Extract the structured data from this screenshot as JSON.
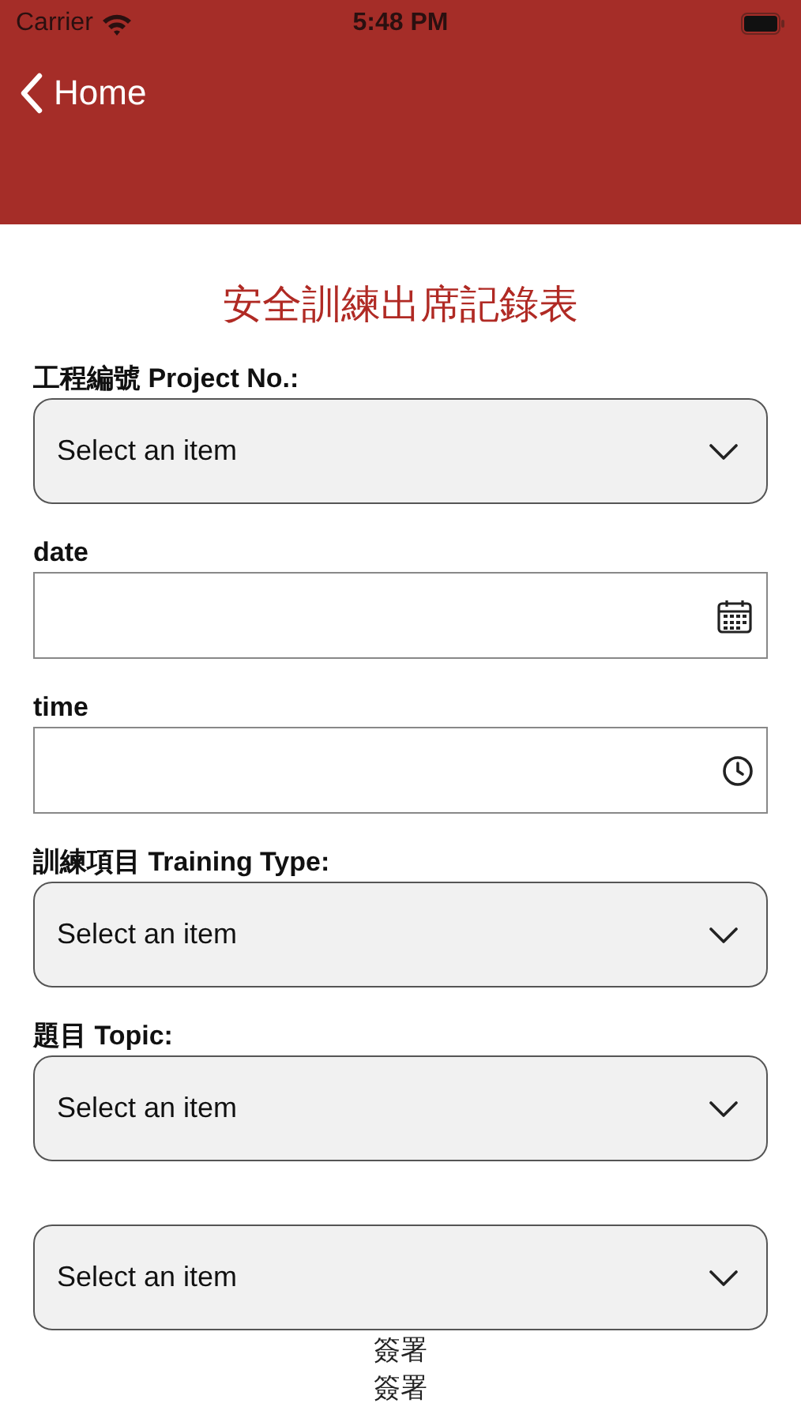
{
  "status_bar": {
    "carrier": "Carrier",
    "time": "5:48 PM"
  },
  "nav": {
    "back_label": "Home"
  },
  "title": "安全訓練出席記錄表",
  "fields": [
    {
      "kind": "select",
      "label": "工程編號 Project No.:",
      "placeholder": "Select an item"
    },
    {
      "kind": "date",
      "label": "date"
    },
    {
      "kind": "time",
      "label": "time"
    },
    {
      "kind": "select",
      "label": "訓練項目 Training Type:",
      "placeholder": "Select an item"
    },
    {
      "kind": "select",
      "label": "題目 Topic:",
      "placeholder": "Select an item"
    },
    {
      "kind": "select",
      "placeholder": "Select an item"
    }
  ],
  "signature_labels": [
    "簽署",
    "簽署"
  ]
}
